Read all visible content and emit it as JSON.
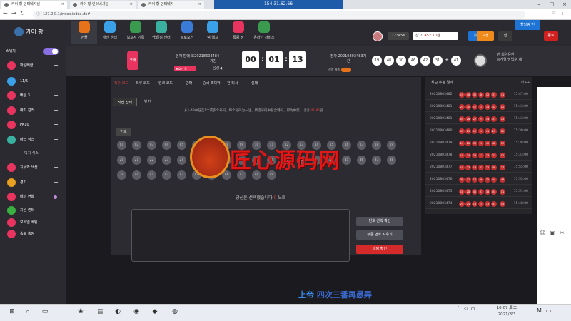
{
  "browser": {
    "tabs": [
      {
        "label": "카이 황 인터네셔널"
      },
      {
        "label": "카이 황 인터네셔널"
      },
      {
        "label": "카이 황 인터네셔"
      }
    ],
    "remote_title": "154.31.62.66",
    "url": "127.0.0.1/index.index.do#"
  },
  "site": {
    "logo": "카이 황",
    "nav": [
      {
        "label": "번들"
      },
      {
        "label": "개인 센터"
      },
      {
        "label": "보고서 기록"
      },
      {
        "label": "代理점 센터"
      },
      {
        "label": "프로모션"
      },
      {
        "label": "덕 웹프"
      },
      {
        "label": "특종 장"
      },
      {
        "label": "온라인 서비스"
      }
    ],
    "user_id": "123456",
    "balance_label": "잔고: ",
    "balance_amount": "452.10",
    "balance_unit": "원",
    "exchange_btn": "대충전",
    "charge_btn": "고정",
    "mypage_btn": "힘",
    "logout_btn": "종료",
    "coupon_tag": "할당량 번"
  },
  "sidebar": {
    "switch_label": "스위치",
    "items": [
      {
        "label": "파일뼈클",
        "color": "#e8345e"
      },
      {
        "label": "11/5",
        "color": "#3aa0e8"
      },
      {
        "label": "빠른 3",
        "color": "#e8345e"
      },
      {
        "label": "해피 컬러",
        "color": "#e8345e"
      },
      {
        "label": "PK10",
        "color": "#e8345e"
      },
      {
        "label": "마크 식스",
        "color": "#3ab0a0"
      }
    ],
    "sub_item": "빅기 식스",
    "items2": [
      {
        "label": "치우와 색상",
        "color": "#e8345e"
      },
      {
        "label": "경기",
        "color": "#e8a020"
      },
      {
        "label": "테마 현황",
        "color": "#e8345e"
      },
      {
        "label": "지원 센터",
        "color": "#3ab040"
      },
      {
        "label": "모바일 베팅",
        "color": "#e8345e"
      },
      {
        "label": "속도 측정",
        "color": "#e8345e"
      }
    ]
  },
  "game": {
    "logo": "코배",
    "current_round_label": "현재 판매 호20218603484",
    "current_round_sub": "기간",
    "round_tag": "★호기 도",
    "sound_label": "음성",
    "timer": {
      "h": "00",
      "m": "01",
      "s": "13"
    },
    "prev_round_label": "전자 20210803483기 간",
    "anim_label": "전개 결과",
    "result_balls": [
      "19",
      "48",
      "30",
      "46",
      "42",
      "31",
      "41"
    ],
    "info_line1": "빈 회원유원",
    "info_line2": "◎게임 방법수 세"
  },
  "bet": {
    "type_tabs": [
      "특수 코드",
      "트루 코드",
      "링크 코드",
      "반파",
      "중국 조디악",
      "전 티서",
      "실패"
    ],
    "sub_tabs": [
      "직접 선택",
      "빈번"
    ],
    "rule_text": "从1-49中任选1个或多个号码，每个号码为一注，所选号码中包含特码，即为中奖。 설상",
    "rule_highlight": "41.85",
    "rule_suffix": "원",
    "num_label": "번호",
    "numbers": [
      "01",
      "02",
      "03",
      "04",
      "05",
      "06",
      "07",
      "08",
      "09",
      "10",
      "11",
      "12",
      "13",
      "14",
      "15",
      "16",
      "17",
      "18",
      "19",
      "20",
      "21",
      "22",
      "23",
      "24",
      "25",
      "26",
      "27",
      "28",
      "29",
      "30",
      "31",
      "32",
      "33",
      "34",
      "35",
      "36",
      "37",
      "38",
      "39",
      "40",
      "41",
      "42",
      "43",
      "44",
      "45",
      "46",
      "47",
      "48",
      "49"
    ],
    "selected_prefix": "당신은 선택했습니다 ",
    "selected_count": "0",
    "selected_suffix": " 노트",
    "btn_confirm": "번호 선택 확인",
    "btn_clear": "주문 번호 지우기",
    "btn_bet": "베팅 확인",
    "watermark": "匠心源码网"
  },
  "recent": {
    "title": "최근 추첨 결과",
    "more": "더++",
    "rows": [
      {
        "id": "20210803482",
        "balls": [
          "19",
          "48",
          "30",
          "46",
          "42",
          "31"
        ],
        "last": "41",
        "time": "15:47:00"
      },
      {
        "id": "20210803481",
        "balls": [
          "25",
          "30",
          "17",
          "14",
          "34",
          "32"
        ],
        "last": "02",
        "time": "15:43:00"
      },
      {
        "id": "20210803481",
        "balls": [
          "05",
          "26",
          "27",
          "24",
          "34",
          "31"
        ],
        "last": "13",
        "time": "15:43:00"
      },
      {
        "id": "20210803480",
        "balls": [
          "05",
          "25",
          "19",
          "26",
          "41",
          "29"
        ],
        "last": "12",
        "time": "15:39:00"
      },
      {
        "id": "20210803479",
        "balls": [
          "24",
          "28",
          "30",
          "20",
          "40",
          "42"
        ],
        "last": "09",
        "time": "15:38:00"
      },
      {
        "id": "20210803478",
        "balls": [
          "10",
          "24",
          "28",
          "13",
          "33",
          "23"
        ],
        "last": "02",
        "time": "15:33:00"
      },
      {
        "id": "20210803477",
        "balls": [
          "10",
          "23",
          "13",
          "43",
          "32",
          "38"
        ],
        "last": "37",
        "time": "15:55:00"
      },
      {
        "id": "20210803476",
        "balls": [
          "38",
          "31",
          "16",
          "26",
          "35",
          "44"
        ],
        "last": "48",
        "time": "15:53:00"
      },
      {
        "id": "20210803475",
        "balls": [
          "18",
          "28",
          "40",
          "37",
          "38",
          "04"
        ],
        "last": "11",
        "time": "15:51:00"
      },
      {
        "id": "20210803474",
        "balls": [
          "24",
          "25",
          "11",
          "19",
          "33",
          "43"
        ],
        "last": "15",
        "time": "15:48:00"
      }
    ]
  },
  "subtitle": {
    "part1": "上帝",
    "part2": "四次三番再愚弄"
  },
  "taskbar": {
    "time": "16:07 周二",
    "date": "2021/8/3"
  }
}
